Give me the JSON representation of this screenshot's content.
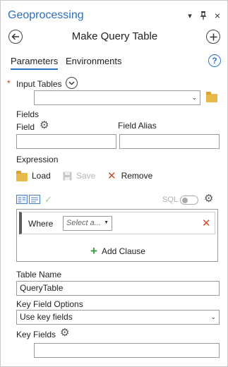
{
  "header": {
    "title": "Geoprocessing",
    "menu_icon": "chevron-down-icon",
    "pin_icon": "pin-icon",
    "close_icon": "close-icon"
  },
  "tool": {
    "title": "Make Query Table",
    "back_icon": "back-arrow-icon",
    "add_icon": "add-icon"
  },
  "tabs": [
    {
      "label": "Parameters",
      "active": true
    },
    {
      "label": "Environments",
      "active": false
    }
  ],
  "help_glyph": "?",
  "input_tables": {
    "label": "Input Tables",
    "required_marker": "*",
    "value": ""
  },
  "fields": {
    "section_label": "Fields",
    "field_label": "Field",
    "alias_label": "Field Alias",
    "field_value": "",
    "alias_value": ""
  },
  "expression": {
    "label": "Expression",
    "load_label": "Load",
    "save_label": "Save",
    "remove_label": "Remove",
    "sql_label": "SQL",
    "where_label": "Where",
    "select_placeholder": "Select a...",
    "add_clause_label": "Add Clause"
  },
  "table_name": {
    "label": "Table Name",
    "value": "QueryTable"
  },
  "key_field_options": {
    "label": "Key Field Options",
    "value": "Use key fields"
  },
  "key_fields": {
    "label": "Key Fields",
    "value": ""
  },
  "colors": {
    "accent": "#2b6fbf",
    "required": "#c0392b",
    "remove": "#d04a2a",
    "add": "#3a9a3a",
    "folder": "#e8b84a"
  }
}
